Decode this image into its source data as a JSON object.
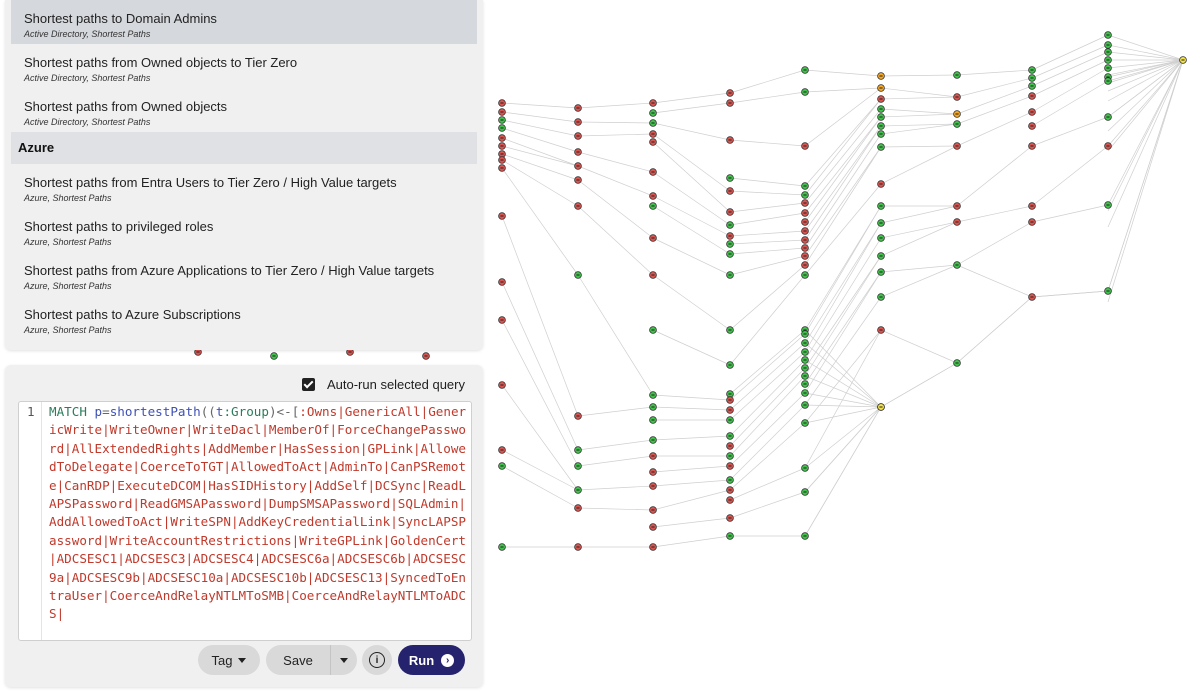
{
  "queries": {
    "items_top": [
      {
        "title": "Shortest paths to Domain Admins",
        "sub": "Active Directory, Shortest Paths",
        "selected": true
      },
      {
        "title": "Shortest paths from Owned objects to Tier Zero",
        "sub": "Active Directory, Shortest Paths"
      },
      {
        "title": "Shortest paths from Owned objects",
        "sub": "Active Directory, Shortest Paths"
      }
    ],
    "section": "Azure",
    "items_azure": [
      {
        "title": "Shortest paths from Entra Users to Tier Zero / High Value targets",
        "sub": "Azure, Shortest Paths"
      },
      {
        "title": "Shortest paths to privileged roles",
        "sub": "Azure, Shortest Paths"
      },
      {
        "title": "Shortest paths from Azure Applications to Tier Zero / High Value targets",
        "sub": "Azure, Shortest Paths"
      },
      {
        "title": "Shortest paths to Azure Subscriptions",
        "sub": "Azure, Shortest Paths"
      }
    ]
  },
  "editor": {
    "autorun_label": "Auto-run selected query",
    "autorun_checked": true,
    "line_number": "1",
    "code_prefix_kw": "MATCH ",
    "code_var_p": "p",
    "code_eq": "=",
    "code_fn": "shortestPath",
    "code_open": "((",
    "code_var_t": "t",
    "code_label": ":Group",
    "code_rel_start": ")<-[",
    "code_rels": ":Owns|GenericAll|GenericWrite|WriteOwner|WriteDacl|MemberOf|ForceChangePassword|AllExtendedRights|AddMember|HasSession|GPLink|AllowedToDelegate|CoerceToTGT|AllowedToAct|AdminTo|CanPSRemote|CanRDP|ExecuteDCOM|HasSIDHistory|AddSelf|DCSync|ReadLAPSPassword|ReadGMSAPassword|DumpSMSAPassword|SQLAdmin|AddAllowedToAct|WriteSPN|AddKeyCredentialLink|SyncLAPSPassword|WriteAccountRestrictions|WriteGPLink|GoldenCert|ADCSESC1|ADCSESC3|ADCSESC4|ADCSESC6a|ADCSESC6b|ADCSESC9a|ADCSESC9b|ADCSESC10a|ADCSESC10b|ADCSESC13|SyncedToEntraUser|CoerceAndRelayNTLMToSMB|CoerceAndRelayNTLMToADCS|"
  },
  "toolbar": {
    "tag_label": "Tag",
    "save_label": "Save",
    "info_glyph": "i",
    "run_label": "Run",
    "run_glyph": "›"
  },
  "icons": {
    "dropdown": "chevron-down-icon",
    "info": "info-icon",
    "run": "arrow-right-icon",
    "checkbox": "checkbox-checked-icon"
  },
  "colors": {
    "node_red": "#d9534f",
    "node_green": "#3fc24a",
    "node_orange": "#f5a623",
    "node_yellow": "#f3e14a",
    "run_button": "#25236e",
    "selected_row": "#d5d8dc"
  }
}
